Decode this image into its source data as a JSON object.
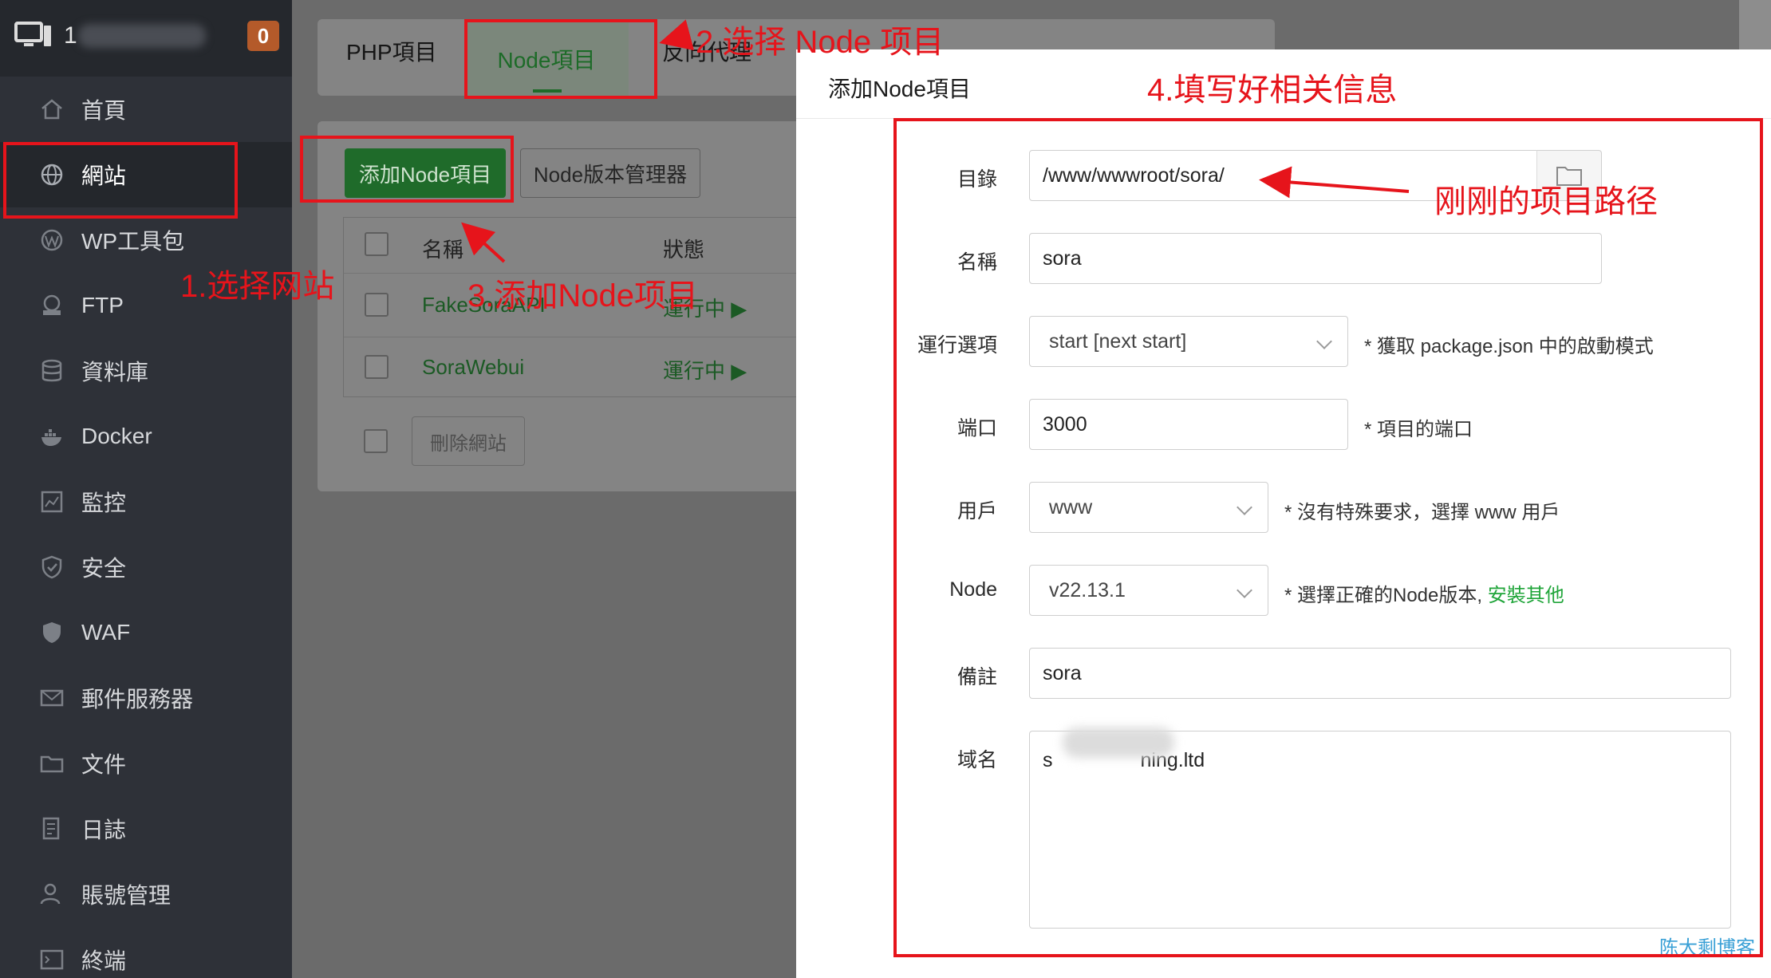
{
  "sidebar": {
    "server_name": "1",
    "badge": "0",
    "items": [
      {
        "label": "首頁",
        "icon": "home-icon"
      },
      {
        "label": "網站",
        "icon": "globe-icon"
      },
      {
        "label": "WP工具包",
        "icon": "wordpress-icon"
      },
      {
        "label": "FTP",
        "icon": "ftp-icon"
      },
      {
        "label": "資料庫",
        "icon": "database-icon"
      },
      {
        "label": "Docker",
        "icon": "docker-icon"
      },
      {
        "label": "監控",
        "icon": "monitor-chart-icon"
      },
      {
        "label": "安全",
        "icon": "shield-check-icon"
      },
      {
        "label": "WAF",
        "icon": "shield-icon"
      },
      {
        "label": "郵件服務器",
        "icon": "mail-icon"
      },
      {
        "label": "文件",
        "icon": "folder-icon"
      },
      {
        "label": "日誌",
        "icon": "log-icon"
      },
      {
        "label": "賬號管理",
        "icon": "user-icon"
      },
      {
        "label": "終端",
        "icon": "terminal-icon"
      }
    ]
  },
  "main": {
    "tabs": [
      {
        "label": "PHP項目"
      },
      {
        "label": "Node項目"
      },
      {
        "label": "反向代理"
      }
    ],
    "add_button": "添加Node項目",
    "node_version_button": "Node版本管理器",
    "table": {
      "headers": [
        "名稱",
        "狀態"
      ],
      "rows": [
        {
          "name": "FakeSoraAPI",
          "status": "運行中"
        },
        {
          "name": "SoraWebui",
          "status": "運行中"
        }
      ]
    },
    "delete_button": "刪除網站"
  },
  "dialog": {
    "title": "添加Node項目",
    "fields": {
      "directory": {
        "label": "目錄",
        "value": "/www/wwwroot/sora/"
      },
      "name": {
        "label": "名稱",
        "value": "sora"
      },
      "run_option": {
        "label": "運行選項",
        "value": "start [next start]",
        "hint": "* 獲取 package.json 中的啟動模式"
      },
      "port": {
        "label": "端口",
        "value": "3000",
        "hint": "* 項目的端口"
      },
      "user": {
        "label": "用戶",
        "value": "www",
        "hint": "* 沒有特殊要求，選擇 www 用戶"
      },
      "node": {
        "label": "Node",
        "value": "v22.13.1",
        "hint": "* 選擇正確的Node版本,",
        "hint_link": "安裝其他"
      },
      "remark": {
        "label": "備註",
        "value": "sora"
      },
      "domain": {
        "label": "域名",
        "value_prefix": "s",
        "value_suffix": "ning.ltd"
      }
    }
  },
  "annotations": {
    "step1": "1.选择网站",
    "step2": "2.选择 Node 项目",
    "step3": "3.添加Node项目",
    "step4": "4.填写好相关信息",
    "path_note": "刚刚的项目路径"
  },
  "watermark": "陈大剩博客",
  "colors": {
    "annotation_red": "#e6141b",
    "brand_green": "#20a53a",
    "sidebar_bg": "#2e3138"
  }
}
